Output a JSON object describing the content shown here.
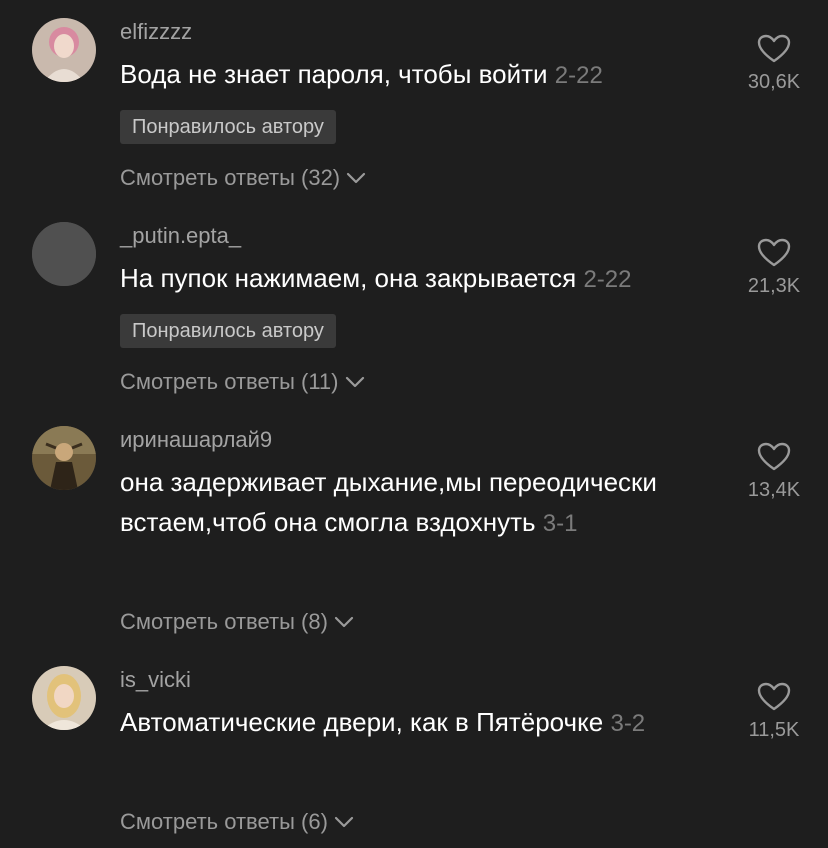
{
  "comments": [
    {
      "username": "elfizzzz",
      "text": "Вода не знает пароля, чтобы войти",
      "date": "2-22",
      "badge": "Понравилось автору",
      "replies": "Смотреть ответы (32)",
      "likes": "30,6K",
      "avatar_icon": "avatar-photo-pink-hair"
    },
    {
      "username": "_putin.epta_",
      "text": "На пупок нажимаем, она закрывается",
      "date": "2-22",
      "badge": "Понравилось автору",
      "replies": "Смотреть ответы (11)",
      "likes": "21,3K",
      "avatar_icon": "avatar-placeholder"
    },
    {
      "username": "иринашарлай9",
      "text": "она задерживает дыхание,мы переодически встаем,чтоб она смогла вздохнуть",
      "date": "3-1",
      "replies": "Смотреть ответы (8)",
      "likes": "13,4K",
      "avatar_icon": "avatar-artwork"
    },
    {
      "username": "is_vicki",
      "text": "Автоматические двери, как в Пятёрочке",
      "date": "3-2",
      "replies": "Смотреть ответы (6)",
      "likes": "11,5K",
      "avatar_icon": "avatar-photo-blonde"
    }
  ],
  "icons": {
    "like": "heart-outline-icon",
    "expand": "chevron-down-icon"
  },
  "colors": {
    "background": "#1e1e1e",
    "username": "#a3a3a3",
    "date": "#7b7b7b",
    "badge_bg": "#3a3a3a",
    "secondary": "#9a9a9a"
  }
}
